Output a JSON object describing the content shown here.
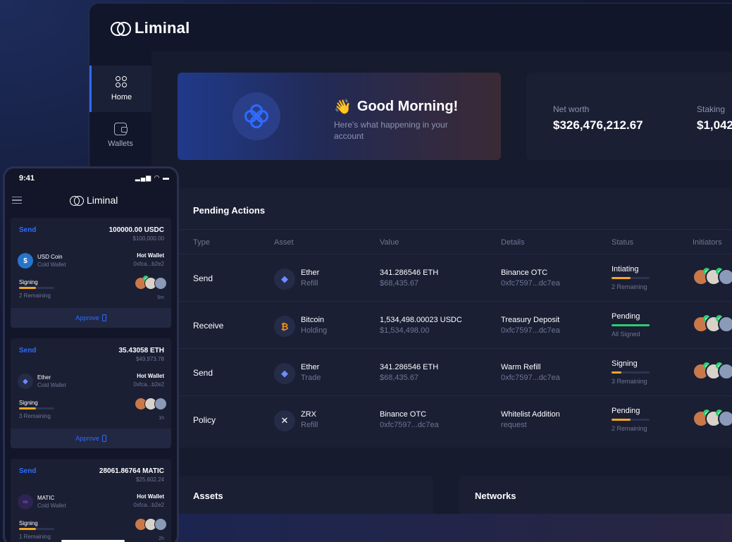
{
  "brand": "Liminal",
  "nav": [
    {
      "label": "Home",
      "icon": "grid-icon",
      "active": true
    },
    {
      "label": "Wallets",
      "icon": "wallet-icon",
      "active": false
    }
  ],
  "hero": {
    "title": "Good Morning!",
    "subtitle": "Here's what happening in your account",
    "emoji": "👋"
  },
  "stats": {
    "net_worth_label": "Net worth",
    "net_worth_value": "$326,476,212.67",
    "staking_label": "Staking",
    "staking_value": "$1,042"
  },
  "pending": {
    "title": "Pending Actions",
    "columns": [
      "Type",
      "Asset",
      "Value",
      "Details",
      "Status",
      "Initiators"
    ],
    "rows": [
      {
        "type": "Send",
        "asset": "Ether",
        "asset_sub": "Refill",
        "icon": "ethereum-icon",
        "value": "341.286546 ETH",
        "value_sub": "$68,435.67",
        "details": "Binance OTC",
        "details_sub": "0xfc7597...dc7ea",
        "status": "Intiating",
        "status_sub": "2 Remaining",
        "progress": 0.5,
        "bar_color": "#f5a623"
      },
      {
        "type": "Receive",
        "asset": "Bitcoin",
        "asset_sub": "Holding",
        "icon": "bitcoin-icon",
        "value": "1,534,498.00023 USDC",
        "value_sub": "$1,534,498.00",
        "details": "Treasury Deposit",
        "details_sub": "0xfc7597...dc7ea",
        "status": "Pending",
        "status_sub": "All Signed",
        "progress": 1.0,
        "bar_color": "#2ecc71"
      },
      {
        "type": "Send",
        "asset": "Ether",
        "asset_sub": "Trade",
        "icon": "ethereum-icon",
        "value": "341.286546 ETH",
        "value_sub": "$68,435.67",
        "details": "Warm Refill",
        "details_sub": "0xfc7597...dc7ea",
        "status": "Signing",
        "status_sub": "3 Remaining",
        "progress": 0.25,
        "bar_color": "#f5a623"
      },
      {
        "type": "Policy",
        "asset": "ZRX",
        "asset_sub": "Refill",
        "icon": "zrx-icon",
        "value": "Binance OTC",
        "value_sub": "0xfc7597...dc7ea",
        "details": "Whitelist Addition",
        "details_sub": "request",
        "status": "Pending",
        "status_sub": "2 Remaining",
        "progress": 0.5,
        "bar_color": "#f5a623"
      }
    ]
  },
  "assets_title": "Assets",
  "networks_title": "Networks",
  "phone": {
    "time": "9:41",
    "system": "▂▄▆ ◠ ▬",
    "brand": "Liminal",
    "cards": [
      {
        "action": "Send",
        "amount": "100000.00 USDC",
        "usd": "$100,000.00",
        "coin": "USD Coin",
        "coin_sub": "Cold Wallet",
        "wallet": "Hot Wallet",
        "addr": "0xfca...b2e2",
        "status": "Signing",
        "remaining": "2 Remaining",
        "time": "5m",
        "approve": "Approve",
        "icon": "usdc-icon"
      },
      {
        "action": "Send",
        "amount": "35.43058 ETH",
        "usd": "$49,973.78",
        "coin": "Ether",
        "coin_sub": "Cold Wallet",
        "wallet": "Hot Wallet",
        "addr": "0xfca...b2e2",
        "status": "Signing",
        "remaining": "3 Remaining",
        "time": "1h",
        "approve": "Approve",
        "icon": "ethereum-icon"
      },
      {
        "action": "Send",
        "amount": "28061.86764 MATIC",
        "usd": "$25,602.24",
        "coin": "MATIC",
        "coin_sub": "Cold Wallet",
        "wallet": "Hot Wallet",
        "addr": "0xfca...b2e2",
        "status": "Signing",
        "remaining": "1 Remaining",
        "time": "2h",
        "approve": "Approve",
        "icon": "matic-icon"
      }
    ]
  },
  "colors": {
    "accent": "#2f6bff",
    "warning": "#f5a623",
    "success": "#2ecc71"
  }
}
